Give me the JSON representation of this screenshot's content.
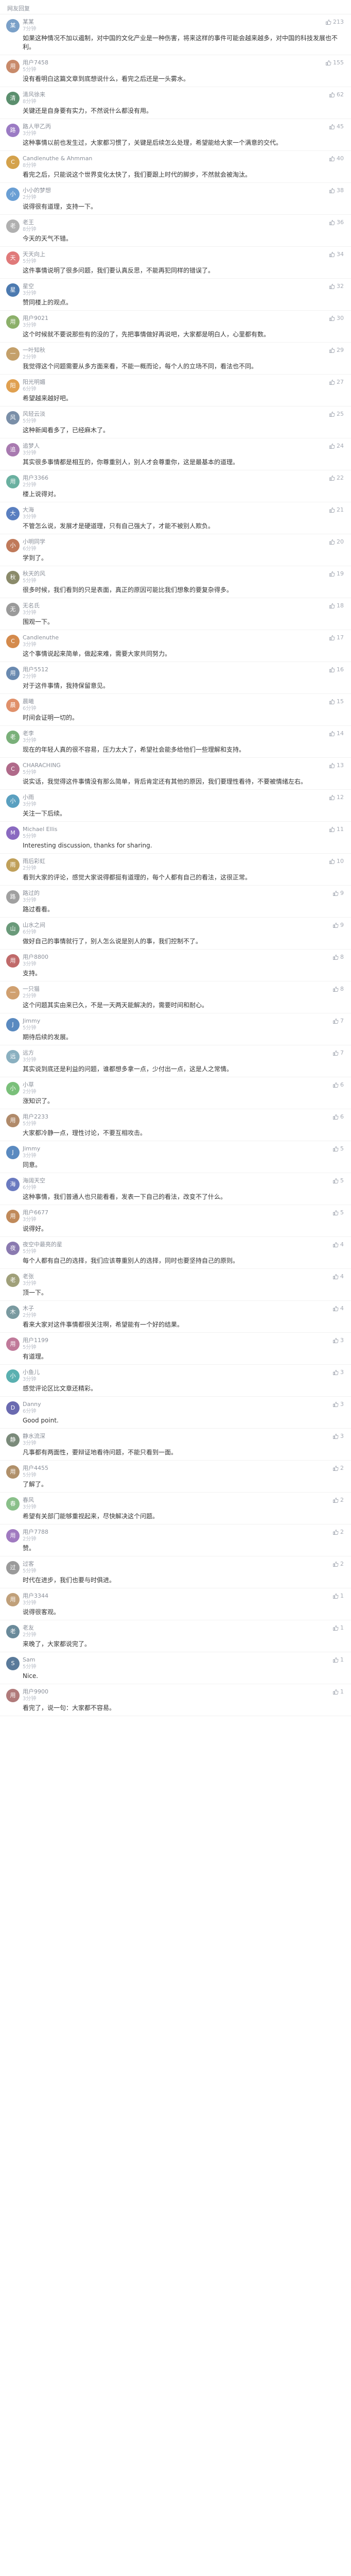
{
  "page": {
    "section_title": "网友回复"
  },
  "colors": {
    "name": "#8a8f99",
    "time": "#b7bcc6",
    "text": "#333333",
    "like": "#a4a9b3"
  },
  "comments": [
    {
      "name": "某某",
      "time": "7分钟",
      "likes": "213",
      "avatar": "#7aa0c8",
      "text": "如果这种情况不加以遏制，对中国的文化产业是一种伤害，将来这样的事件可能会越来越多，对中国的科技发展也不利。"
    },
    {
      "name": "用户7458",
      "time": "5分钟",
      "likes": "155",
      "avatar": "#c88a6a",
      "text": "没有看明白这篇文章到底想说什么，看完之后还是一头雾水。"
    },
    {
      "name": "清风徐来",
      "time": "8分钟",
      "likes": "62",
      "avatar": "#5b8f6e",
      "text": "关键还是自身要有实力，不然说什么都没有用。"
    },
    {
      "name": "路人甲乙丙",
      "time": "3分钟",
      "likes": "45",
      "avatar": "#9b7bc4",
      "text": "这种事情以前也发生过，大家都习惯了，关键是后续怎么处理，希望能给大家一个满意的交代。"
    },
    {
      "name": "Candlenuthe & Ahmman",
      "time": "8分钟",
      "likes": "40",
      "avatar": "#d4a24c",
      "text": "看完之后，只能说这个世界变化太快了，我们要跟上时代的脚步，不然就会被淘汰。"
    },
    {
      "name": "小小的梦想",
      "time": "2分钟",
      "likes": "38",
      "avatar": "#6a9fd4",
      "text": "说得很有道理，支持一下。"
    },
    {
      "name": "老王",
      "time": "8分钟",
      "likes": "36",
      "avatar": "#b0b0b0",
      "text": "今天的天气不错。"
    },
    {
      "name": "天天向上",
      "time": "5分钟",
      "likes": "34",
      "avatar": "#e07a7a",
      "text": "这件事情说明了很多问题，我们要认真反思，不能再犯同样的错误了。"
    },
    {
      "name": "星空",
      "time": "3分钟",
      "likes": "32",
      "avatar": "#4c7ab0",
      "text": "赞同楼上的观点。"
    },
    {
      "name": "用户9021",
      "time": "3分钟",
      "likes": "30",
      "avatar": "#8cb06a",
      "text": "这个时候就不要说那些有的没的了，先把事情做好再说吧，大家都是明白人，心里都有数。"
    },
    {
      "name": "一叶知秋",
      "time": "2分钟",
      "likes": "29",
      "avatar": "#c4a06a",
      "text": "我觉得这个问题需要从多方面来看，不能一概而论，每个人的立场不同，看法也不同。"
    },
    {
      "name": "阳光明媚",
      "time": "6分钟",
      "likes": "27",
      "avatar": "#e0a050",
      "text": "希望越来越好吧。"
    },
    {
      "name": "风轻云淡",
      "time": "5分钟",
      "likes": "25",
      "avatar": "#7a8fa8",
      "text": "这种新闻看多了，已经麻木了。"
    },
    {
      "name": "追梦人",
      "time": "3分钟",
      "likes": "24",
      "avatar": "#a87ab0",
      "text": "其实很多事情都是相互的，你尊重别人，别人才会尊重你，这是最基本的道理。"
    },
    {
      "name": "用户3366",
      "time": "2分钟",
      "likes": "22",
      "avatar": "#6ab0a0",
      "text": "楼上说得对。"
    },
    {
      "name": "大海",
      "time": "3分钟",
      "likes": "21",
      "avatar": "#5a7fc0",
      "text": "不管怎么说，发展才是硬道理，只有自己强大了，才能不被别人欺负。"
    },
    {
      "name": "小明同学",
      "time": "6分钟",
      "likes": "20",
      "avatar": "#c07a5a",
      "text": "学到了。"
    },
    {
      "name": "秋天的风",
      "time": "5分钟",
      "likes": "19",
      "avatar": "#8a8a6a",
      "text": "很多时候，我们看到的只是表面，真正的原因可能比我们想象的要复杂得多。"
    },
    {
      "name": "无名氏",
      "time": "3分钟",
      "likes": "18",
      "avatar": "#9a9a9a",
      "text": "围观一下。"
    },
    {
      "name": "Candlenuthe",
      "time": "3分钟",
      "likes": "17",
      "avatar": "#d48a4c",
      "text": "这个事情说起来简单，做起来难，需要大家共同努力。"
    },
    {
      "name": "用户5512",
      "time": "2分钟",
      "likes": "16",
      "avatar": "#6a8ab0",
      "text": "对于这件事情，我持保留意见。"
    },
    {
      "name": "晨曦",
      "time": "6分钟",
      "likes": "15",
      "avatar": "#e0906a",
      "text": "时间会证明一切的。"
    },
    {
      "name": "老李",
      "time": "3分钟",
      "likes": "14",
      "avatar": "#7ab07a",
      "text": "现在的年轻人真的很不容易，压力太大了，希望社会能多给他们一些理解和支持。"
    },
    {
      "name": "CHARACHING",
      "time": "5分钟",
      "likes": "13",
      "avatar": "#b06a8a",
      "text": "说实话，我觉得这件事情没有那么简单，背后肯定还有其他的原因，我们要理性看待，不要被情绪左右。"
    },
    {
      "name": "小雨",
      "time": "3分钟",
      "likes": "12",
      "avatar": "#5aa0c0",
      "text": "关注一下后续。"
    },
    {
      "name": "Michael Ellis",
      "time": "5分钟",
      "likes": "11",
      "avatar": "#8a6ac0",
      "text": "Interesting discussion, thanks for sharing."
    },
    {
      "name": "雨后彩虹",
      "time": "2分钟",
      "likes": "10",
      "avatar": "#c0a05a",
      "text": "看到大家的评论，感觉大家说得都挺有道理的，每个人都有自己的看法，这很正常。"
    },
    {
      "name": "路过的",
      "time": "3分钟",
      "likes": "9",
      "avatar": "#a0a0a0",
      "text": "路过看看。"
    },
    {
      "name": "山水之间",
      "time": "6分钟",
      "likes": "9",
      "avatar": "#6a9a7a",
      "text": "做好自己的事情就行了，别人怎么说是别人的事，我们控制不了。"
    },
    {
      "name": "用户8800",
      "time": "3分钟",
      "likes": "8",
      "avatar": "#c06a6a",
      "text": "支持。"
    },
    {
      "name": "一只猫",
      "time": "2分钟",
      "likes": "8",
      "avatar": "#d0a070",
      "text": "这个问题其实由来已久，不是一天两天能解决的，需要时间和耐心。"
    },
    {
      "name": "Jimmy",
      "time": "5分钟",
      "likes": "7",
      "avatar": "#5a8ac0",
      "text": "期待后续的发展。"
    },
    {
      "name": "远方",
      "time": "3分钟",
      "likes": "7",
      "avatar": "#8ab0c0",
      "text": "其实说到底还是利益的问题，谁都想多拿一点，少付出一点，这是人之常情。"
    },
    {
      "name": "小草",
      "time": "2分钟",
      "likes": "6",
      "avatar": "#7ac07a",
      "text": "涨知识了。"
    },
    {
      "name": "用户2233",
      "time": "5分钟",
      "likes": "6",
      "avatar": "#b08a6a",
      "text": "大家都冷静一点，理性讨论，不要互相攻击。"
    },
    {
      "name": "Jimmy",
      "time": "3分钟",
      "likes": "5",
      "avatar": "#5a8ac0",
      "text": "同意。"
    },
    {
      "name": "海阔天空",
      "time": "6分钟",
      "likes": "5",
      "avatar": "#6a7ac0",
      "text": "这种事情，我们普通人也只能看看，发表一下自己的看法，改变不了什么。"
    },
    {
      "name": "用户6677",
      "time": "3分钟",
      "likes": "5",
      "avatar": "#c08a5a",
      "text": "说得好。"
    },
    {
      "name": "夜空中最亮的星",
      "time": "5分钟",
      "likes": "4",
      "avatar": "#8a7ab0",
      "text": "每个人都有自己的选择，我们应该尊重别人的选择，同时也要坚持自己的原则。"
    },
    {
      "name": "老张",
      "time": "3分钟",
      "likes": "4",
      "avatar": "#a0a07a",
      "text": "顶一下。"
    },
    {
      "name": "木子",
      "time": "2分钟",
      "likes": "4",
      "avatar": "#7a9aa0",
      "text": "看来大家对这件事情都很关注啊，希望能有一个好的结果。"
    },
    {
      "name": "用户1199",
      "time": "5分钟",
      "likes": "3",
      "avatar": "#c07a9a",
      "text": "有道理。"
    },
    {
      "name": "小鱼儿",
      "time": "3分钟",
      "likes": "3",
      "avatar": "#5ab0b0",
      "text": "感觉评论区比文章还精彩。"
    },
    {
      "name": "Danny",
      "time": "6分钟",
      "likes": "3",
      "avatar": "#6a6ab0",
      "text": "Good point."
    },
    {
      "name": "静水流深",
      "time": "3分钟",
      "likes": "3",
      "avatar": "#7a8a7a",
      "text": "凡事都有两面性，要辩证地看待问题，不能只看到一面。"
    },
    {
      "name": "用户4455",
      "time": "5分钟",
      "likes": "2",
      "avatar": "#b0906a",
      "text": "了解了。"
    },
    {
      "name": "春风",
      "time": "3分钟",
      "likes": "2",
      "avatar": "#8ac08a",
      "text": "希望有关部门能够重视起来，尽快解决这个问题。"
    },
    {
      "name": "用户7788",
      "time": "2分钟",
      "likes": "2",
      "avatar": "#a07ac0",
      "text": "赞。"
    },
    {
      "name": "过客",
      "time": "5分钟",
      "likes": "2",
      "avatar": "#9a9a9a",
      "text": "时代在进步，我们也要与时俱进。"
    },
    {
      "name": "用户3344",
      "time": "3分钟",
      "likes": "1",
      "avatar": "#c0a07a",
      "text": "说得很客观。"
    },
    {
      "name": "老友",
      "time": "2分钟",
      "likes": "1",
      "avatar": "#6a8a9a",
      "text": "来晚了，大家都说完了。"
    },
    {
      "name": "Sam",
      "time": "5分钟",
      "likes": "1",
      "avatar": "#5a7a9a",
      "text": "Nice."
    },
    {
      "name": "用户9900",
      "time": "3分钟",
      "likes": "1",
      "avatar": "#b07a7a",
      "text": "看完了，说一句：大家都不容易。"
    }
  ]
}
